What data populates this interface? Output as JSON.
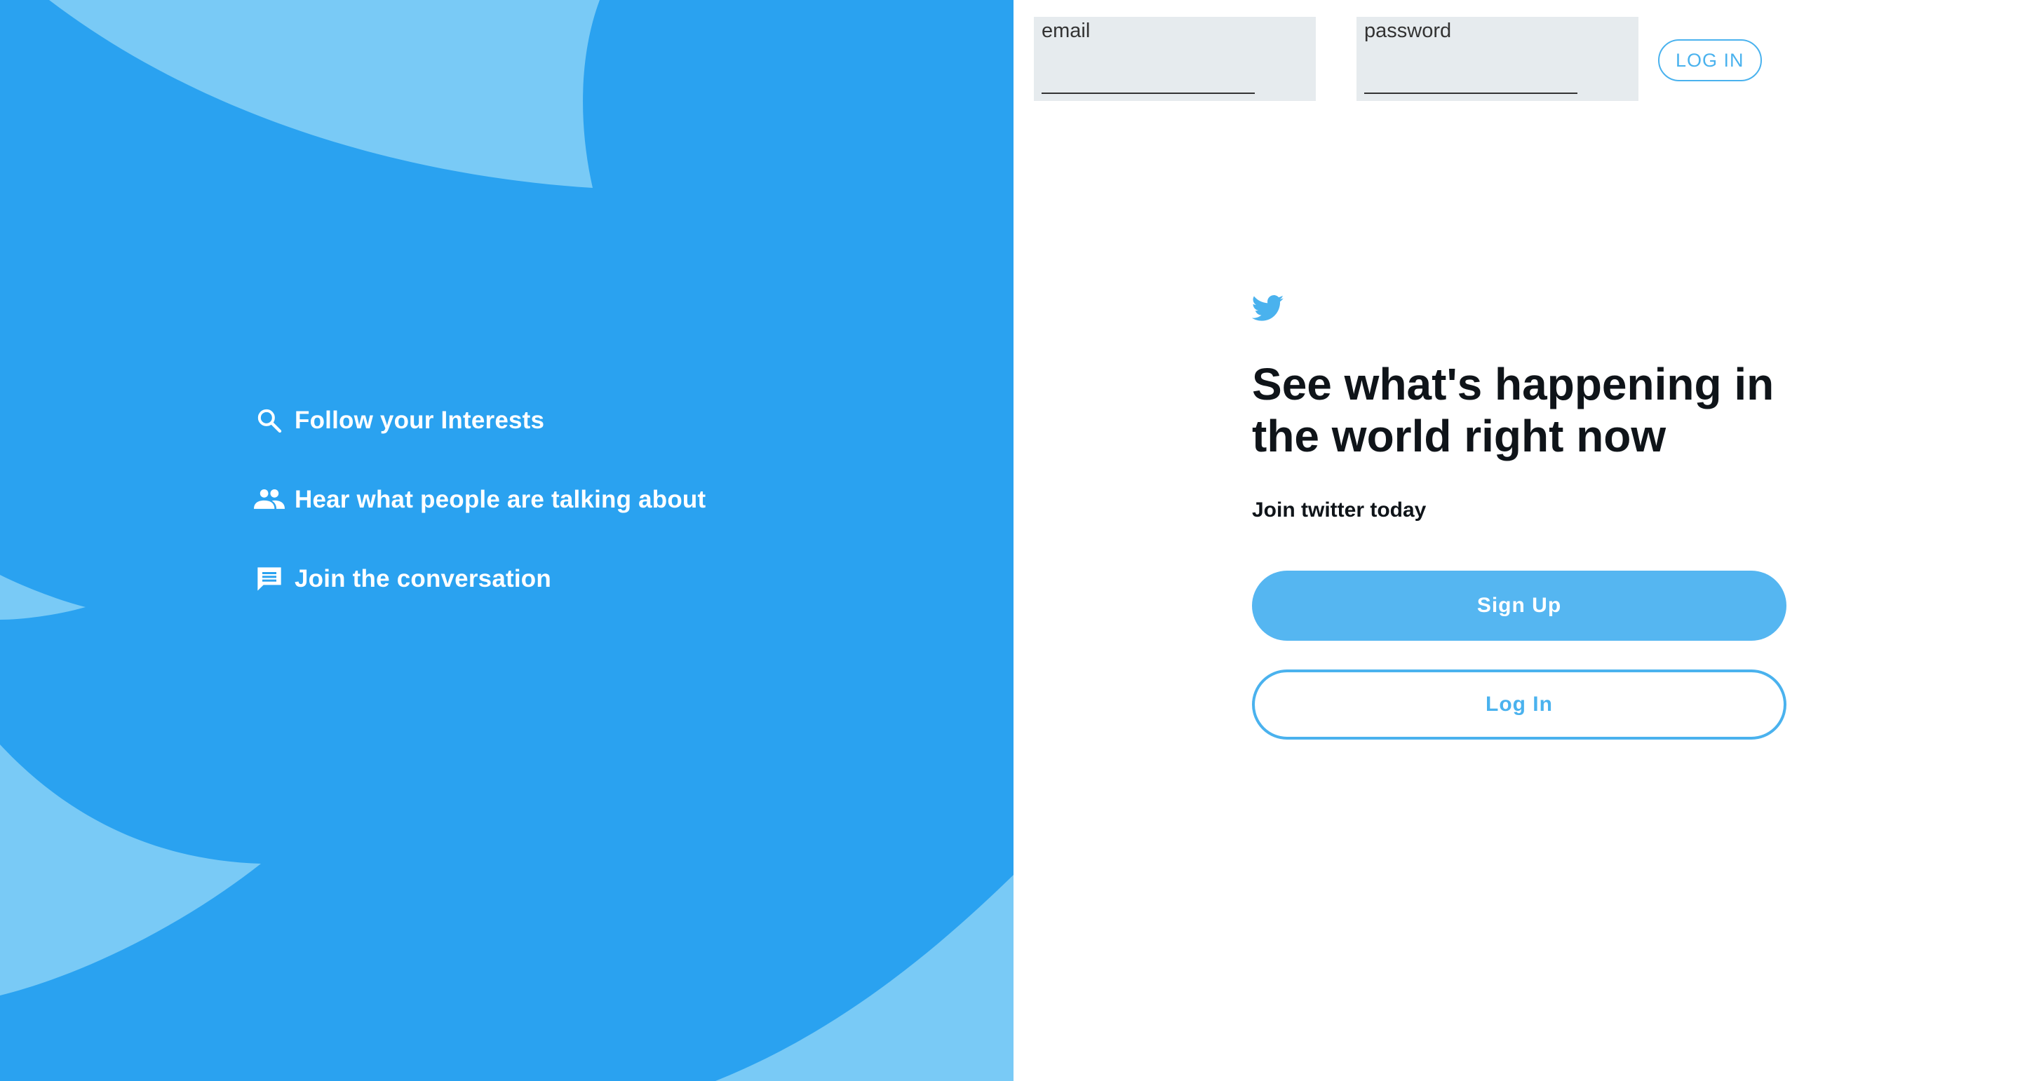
{
  "left_panel": {
    "background_color": "#2aa2f0",
    "art_color": "#79caf6",
    "features": [
      {
        "icon": "search-icon",
        "label": "Follow your Interests"
      },
      {
        "icon": "people-icon",
        "label": "Hear what people are talking about"
      },
      {
        "icon": "chat-icon",
        "label": "Join the conversation"
      }
    ]
  },
  "login_bar": {
    "email_label": "email",
    "email_value": "",
    "password_label": "password",
    "password_value": "",
    "login_button": "LOG IN"
  },
  "hero": {
    "logo_icon": "twitter-bird-icon",
    "headline": "See what's happening in the world right now",
    "subhead": "Join twitter today",
    "signup_button": "Sign Up",
    "login_button": "Log In"
  },
  "colors": {
    "brand": "#4ab2ee",
    "signup_fill": "#55b6f1",
    "field_bg": "#e6ebee"
  }
}
